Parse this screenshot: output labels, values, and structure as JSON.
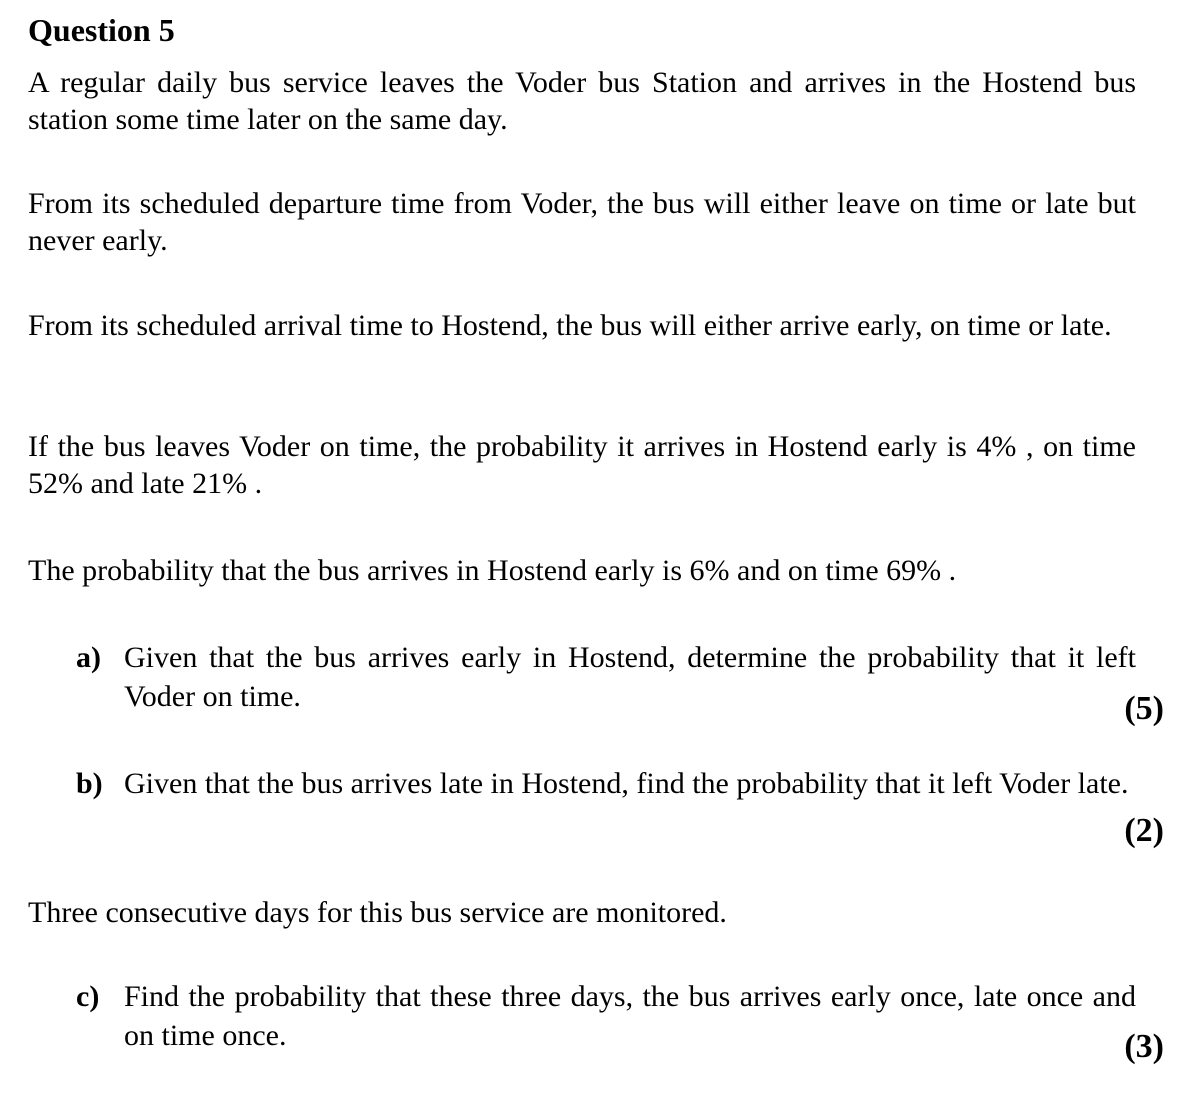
{
  "question": {
    "title": "Question 5",
    "paragraphs": [
      "A regular daily bus service leaves the Voder bus Station and arrives in the Hostend bus station some time later on the same day.",
      "From its scheduled departure time from Voder, the bus will either leave on time or late but never early.",
      "From its scheduled arrival time to Hostend, the bus will either arrive early, on time or late.",
      "If the bus leaves Voder on time, the probability it arrives in Hostend early is  4% , on time  52% and late 21% .",
      "The probability that the bus arrives in Hostend early is  6% and on time  69% .",
      "Three consecutive days for this bus service are monitored."
    ],
    "parts": [
      {
        "letter": "a)",
        "text": "Given that the bus arrives early in Hostend, determine the probability that it left Voder on time.",
        "marks": "(5)"
      },
      {
        "letter": "b)",
        "text": "Given that the bus arrives late in Hostend, find the probability that it left Voder late.",
        "marks": "(2)"
      },
      {
        "letter": "c)",
        "text": "Find the probability that these three days, the bus arrives early once, late once and on time once.",
        "marks": "(3)"
      }
    ]
  }
}
